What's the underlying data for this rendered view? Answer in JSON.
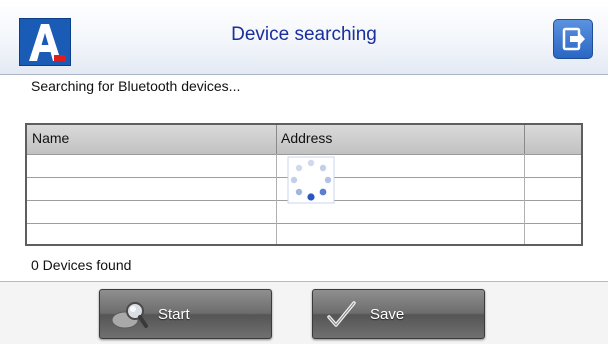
{
  "header": {
    "title": "Device searching",
    "logo_letter": "A",
    "logo_icon": "app-logo-icon",
    "exit_icon": "exit-icon"
  },
  "status": {
    "searching_text": "Searching for Bluetooth devices..."
  },
  "device_list": {
    "columns": [
      "Name",
      "Address",
      ""
    ],
    "rows": [],
    "loading_indicator": "spinner-icon"
  },
  "found_count_text": "0 Devices found",
  "footer": {
    "start_label": "Start",
    "start_icon": "search-icon",
    "save_label": "Save",
    "save_icon": "checkmark-icon"
  },
  "colors": {
    "title_text": "#1a2f9a",
    "logo_blue": "#1a5bb6",
    "logo_red": "#e01e1e",
    "button_gray": "#6d6d6d"
  }
}
